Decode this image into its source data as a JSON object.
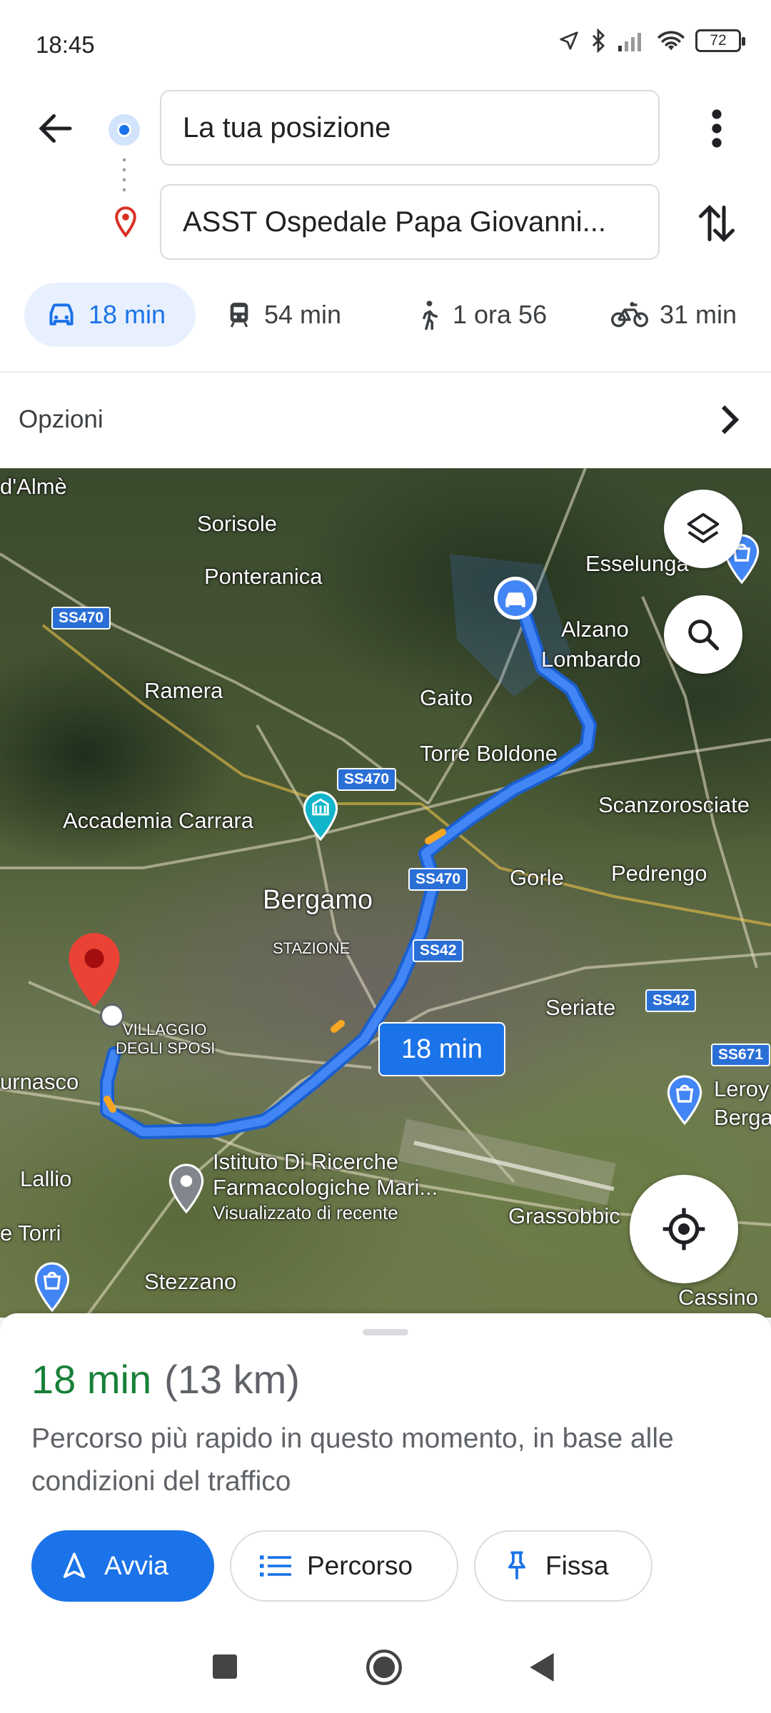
{
  "status_bar": {
    "time": "18:45",
    "battery": "72"
  },
  "directions": {
    "origin": "La tua posizione",
    "destination": "ASST Ospedale Papa Giovanni..."
  },
  "modes": [
    {
      "icon": "car-icon",
      "label": "18 min",
      "active": true
    },
    {
      "icon": "train-icon",
      "label": "54 min"
    },
    {
      "icon": "walk-icon",
      "label": "1 ora 56"
    },
    {
      "icon": "bike-icon",
      "label": "31 min"
    }
  ],
  "options_label": "Opzioni",
  "map": {
    "route_time": "18 min",
    "places": {
      "almè": "d'Almè",
      "sorisole": "Sorisole",
      "ponteranica": "Ponteranica",
      "esselunga": "Esselunga",
      "alzano": "Alzano",
      "lombardo": "Lombardo",
      "ramera": "Ramera",
      "gaito": "Gaito",
      "torre_boldone": "Torre Boldone",
      "scanzorosciate": "Scanzorosciate",
      "accademia": "Accademia Carrara",
      "gorle": "Gorle",
      "pedrengo": "Pedrengo",
      "bergamo": "Bergamo",
      "stazione": "STAZIONE",
      "seriate": "Seriate",
      "villaggio": "VILLAGGIO",
      "degli_sposi": "DEGLI SPOSI",
      "curnasco": "urnasco",
      "leroy": "Leroy",
      "berga": "Berga",
      "istituto1": "Istituto Di Ricerche",
      "istituto2": "Farmacologiche Mari...",
      "visualizzato": "Visualizzato di recente",
      "lallio": "Lallio",
      "torri": "e Torri",
      "grassobbio": "Grassobbic",
      "stezzano": "Stezzano",
      "cassino": "Cassino"
    },
    "roads": {
      "ss470_a": "SS470",
      "ss470_b": "SS470",
      "ss470_c": "SS470",
      "ss42_a": "SS42",
      "ss42_b": "SS42",
      "ss671": "SS671"
    }
  },
  "sheet": {
    "duration": "18 min",
    "distance": "(13 km)",
    "description": "Percorso più rapido in questo momento, in base alle condizioni del traffico",
    "start_label": "Avvia",
    "steps_label": "Percorso",
    "pin_label": "Fissa"
  },
  "colors": {
    "accent": "#1a73e8",
    "duration_green": "#188038",
    "route_blue": "#4285f4"
  }
}
